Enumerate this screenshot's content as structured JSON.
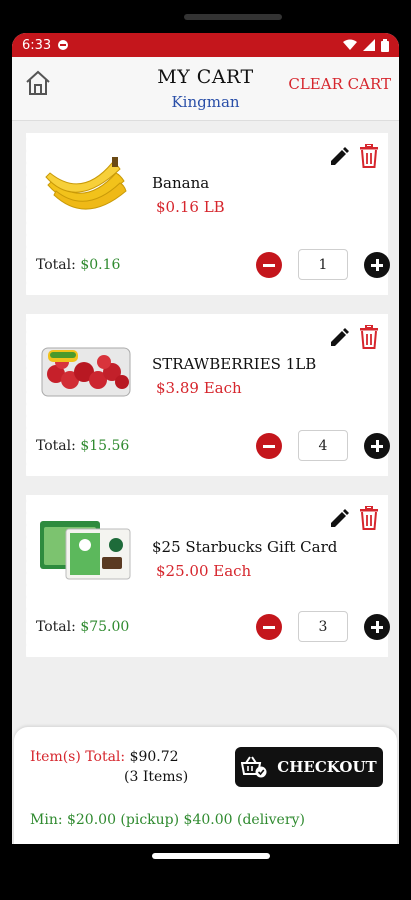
{
  "status": {
    "time": "6:33"
  },
  "header": {
    "title": "MY CART",
    "subtitle": "Kingman",
    "clear_label": "CLEAR CART"
  },
  "items": [
    {
      "name": "Banana",
      "price": "$0.16 LB",
      "total_label": "Total:",
      "total": "$0.16",
      "qty": "1"
    },
    {
      "name": "STRAWBERRIES 1LB",
      "price": "$3.89 Each",
      "total_label": "Total:",
      "total": "$15.56",
      "qty": "4"
    },
    {
      "name": "$25 Starbucks Gift Card",
      "price": "$25.00 Each",
      "total_label": "Total:",
      "total": "$75.00",
      "qty": "3"
    }
  ],
  "summary": {
    "items_total_label": "Item(s) Total:",
    "items_total_value": "$90.72",
    "items_count": "(3 Items)",
    "checkout_label": "CHECKOUT",
    "minimum": "Min: $20.00 (pickup) $40.00 (delivery)"
  },
  "colors": {
    "accent": "#c4161c",
    "price": "#d6262d",
    "total": "#2f8a2f",
    "subtitle": "#2a4fa8"
  }
}
